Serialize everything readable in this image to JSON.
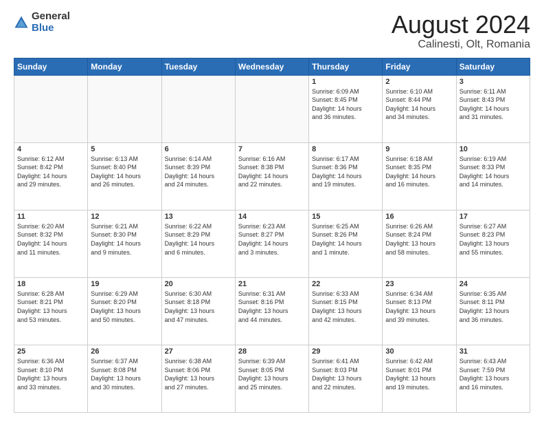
{
  "header": {
    "logo_general": "General",
    "logo_blue": "Blue",
    "month_title": "August 2024",
    "location": "Calinesti, Olt, Romania"
  },
  "days_of_week": [
    "Sunday",
    "Monday",
    "Tuesday",
    "Wednesday",
    "Thursday",
    "Friday",
    "Saturday"
  ],
  "weeks": [
    [
      {
        "day": "",
        "info": ""
      },
      {
        "day": "",
        "info": ""
      },
      {
        "day": "",
        "info": ""
      },
      {
        "day": "",
        "info": ""
      },
      {
        "day": "1",
        "info": "Sunrise: 6:09 AM\nSunset: 8:45 PM\nDaylight: 14 hours\nand 36 minutes."
      },
      {
        "day": "2",
        "info": "Sunrise: 6:10 AM\nSunset: 8:44 PM\nDaylight: 14 hours\nand 34 minutes."
      },
      {
        "day": "3",
        "info": "Sunrise: 6:11 AM\nSunset: 8:43 PM\nDaylight: 14 hours\nand 31 minutes."
      }
    ],
    [
      {
        "day": "4",
        "info": "Sunrise: 6:12 AM\nSunset: 8:42 PM\nDaylight: 14 hours\nand 29 minutes."
      },
      {
        "day": "5",
        "info": "Sunrise: 6:13 AM\nSunset: 8:40 PM\nDaylight: 14 hours\nand 26 minutes."
      },
      {
        "day": "6",
        "info": "Sunrise: 6:14 AM\nSunset: 8:39 PM\nDaylight: 14 hours\nand 24 minutes."
      },
      {
        "day": "7",
        "info": "Sunrise: 6:16 AM\nSunset: 8:38 PM\nDaylight: 14 hours\nand 22 minutes."
      },
      {
        "day": "8",
        "info": "Sunrise: 6:17 AM\nSunset: 8:36 PM\nDaylight: 14 hours\nand 19 minutes."
      },
      {
        "day": "9",
        "info": "Sunrise: 6:18 AM\nSunset: 8:35 PM\nDaylight: 14 hours\nand 16 minutes."
      },
      {
        "day": "10",
        "info": "Sunrise: 6:19 AM\nSunset: 8:33 PM\nDaylight: 14 hours\nand 14 minutes."
      }
    ],
    [
      {
        "day": "11",
        "info": "Sunrise: 6:20 AM\nSunset: 8:32 PM\nDaylight: 14 hours\nand 11 minutes."
      },
      {
        "day": "12",
        "info": "Sunrise: 6:21 AM\nSunset: 8:30 PM\nDaylight: 14 hours\nand 9 minutes."
      },
      {
        "day": "13",
        "info": "Sunrise: 6:22 AM\nSunset: 8:29 PM\nDaylight: 14 hours\nand 6 minutes."
      },
      {
        "day": "14",
        "info": "Sunrise: 6:23 AM\nSunset: 8:27 PM\nDaylight: 14 hours\nand 3 minutes."
      },
      {
        "day": "15",
        "info": "Sunrise: 6:25 AM\nSunset: 8:26 PM\nDaylight: 14 hours\nand 1 minute."
      },
      {
        "day": "16",
        "info": "Sunrise: 6:26 AM\nSunset: 8:24 PM\nDaylight: 13 hours\nand 58 minutes."
      },
      {
        "day": "17",
        "info": "Sunrise: 6:27 AM\nSunset: 8:23 PM\nDaylight: 13 hours\nand 55 minutes."
      }
    ],
    [
      {
        "day": "18",
        "info": "Sunrise: 6:28 AM\nSunset: 8:21 PM\nDaylight: 13 hours\nand 53 minutes."
      },
      {
        "day": "19",
        "info": "Sunrise: 6:29 AM\nSunset: 8:20 PM\nDaylight: 13 hours\nand 50 minutes."
      },
      {
        "day": "20",
        "info": "Sunrise: 6:30 AM\nSunset: 8:18 PM\nDaylight: 13 hours\nand 47 minutes."
      },
      {
        "day": "21",
        "info": "Sunrise: 6:31 AM\nSunset: 8:16 PM\nDaylight: 13 hours\nand 44 minutes."
      },
      {
        "day": "22",
        "info": "Sunrise: 6:33 AM\nSunset: 8:15 PM\nDaylight: 13 hours\nand 42 minutes."
      },
      {
        "day": "23",
        "info": "Sunrise: 6:34 AM\nSunset: 8:13 PM\nDaylight: 13 hours\nand 39 minutes."
      },
      {
        "day": "24",
        "info": "Sunrise: 6:35 AM\nSunset: 8:11 PM\nDaylight: 13 hours\nand 36 minutes."
      }
    ],
    [
      {
        "day": "25",
        "info": "Sunrise: 6:36 AM\nSunset: 8:10 PM\nDaylight: 13 hours\nand 33 minutes."
      },
      {
        "day": "26",
        "info": "Sunrise: 6:37 AM\nSunset: 8:08 PM\nDaylight: 13 hours\nand 30 minutes."
      },
      {
        "day": "27",
        "info": "Sunrise: 6:38 AM\nSunset: 8:06 PM\nDaylight: 13 hours\nand 27 minutes."
      },
      {
        "day": "28",
        "info": "Sunrise: 6:39 AM\nSunset: 8:05 PM\nDaylight: 13 hours\nand 25 minutes."
      },
      {
        "day": "29",
        "info": "Sunrise: 6:41 AM\nSunset: 8:03 PM\nDaylight: 13 hours\nand 22 minutes."
      },
      {
        "day": "30",
        "info": "Sunrise: 6:42 AM\nSunset: 8:01 PM\nDaylight: 13 hours\nand 19 minutes."
      },
      {
        "day": "31",
        "info": "Sunrise: 6:43 AM\nSunset: 7:59 PM\nDaylight: 13 hours\nand 16 minutes."
      }
    ]
  ]
}
